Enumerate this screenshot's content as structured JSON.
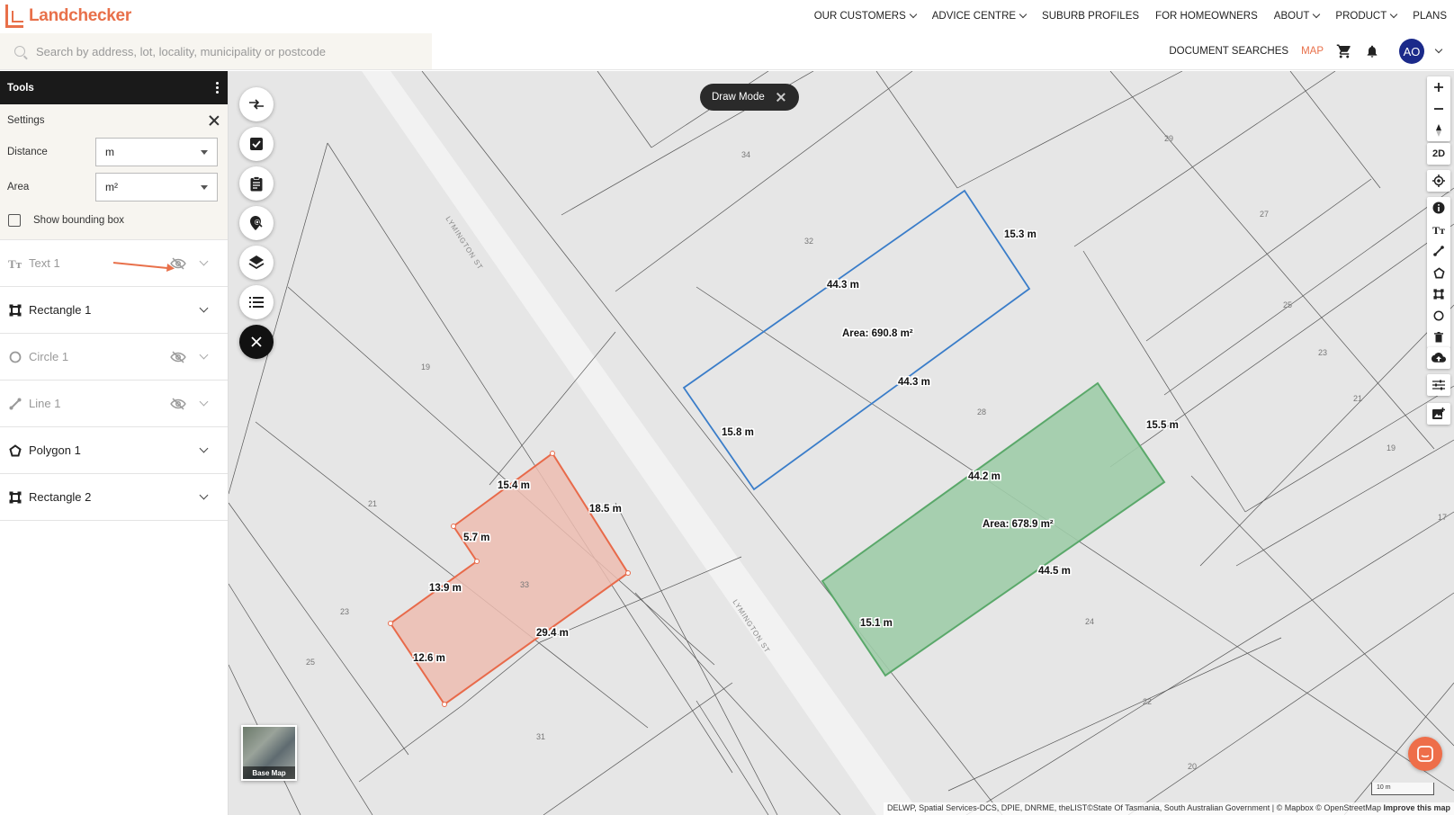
{
  "brand": {
    "name": "Landchecker",
    "color": "#e8704a"
  },
  "nav": [
    {
      "label": "OUR CUSTOMERS",
      "dropdown": true
    },
    {
      "label": "ADVICE CENTRE",
      "dropdown": true
    },
    {
      "label": "SUBURB PROFILES",
      "dropdown": false
    },
    {
      "label": "FOR HOMEOWNERS",
      "dropdown": false
    },
    {
      "label": "ABOUT",
      "dropdown": true
    },
    {
      "label": "PRODUCT",
      "dropdown": true
    },
    {
      "label": "PLANS",
      "dropdown": false
    }
  ],
  "search": {
    "placeholder": "Search by address, lot, locality, municipality or postcode",
    "value": ""
  },
  "subnav": {
    "document_searches": "DOCUMENT SEARCHES",
    "map": "MAP",
    "avatar_initials": "AO"
  },
  "sidebar": {
    "title": "Tools",
    "settings": {
      "title": "Settings",
      "distance_label": "Distance",
      "distance_value": "m",
      "area_label": "Area",
      "area_value": "m²",
      "bounding_box_label": "Show bounding box",
      "bounding_box_checked": false
    },
    "layers": [
      {
        "name": "Text 1",
        "icon": "text-icon",
        "hidden": true
      },
      {
        "name": "Rectangle 1",
        "icon": "rectangle-icon",
        "hidden": false
      },
      {
        "name": "Circle 1",
        "icon": "circle-icon",
        "hidden": true
      },
      {
        "name": "Line 1",
        "icon": "line-icon",
        "hidden": true
      },
      {
        "name": "Polygon 1",
        "icon": "polygon-icon",
        "hidden": false
      },
      {
        "name": "Rectangle 2",
        "icon": "rectangle-icon",
        "hidden": false
      }
    ]
  },
  "map": {
    "draw_mode_label": "Draw Mode",
    "view_toggle": "2D",
    "base_map_label": "Base Map",
    "scale_label": "10 m",
    "attribution": "DELWP, Spatial Services-DCS, DPIE, DNRME, theLIST©State Of Tasmania, South Australian Government | © Mapbox © OpenStreetMap",
    "attribution_link": "Improve this map",
    "streets": [
      "LYMINGTON ST",
      "LYMINGTON ST"
    ],
    "parcel_numbers": [
      "34",
      "29",
      "32",
      "27",
      "25",
      "23",
      "21",
      "19",
      "17",
      "28",
      "24",
      "22",
      "20",
      "19",
      "21",
      "23",
      "25",
      "33",
      "31"
    ],
    "blue_shape": {
      "color": "#3a7dc9",
      "edges": [
        "15.3 m",
        "44.3 m",
        "44.3 m",
        "15.8 m"
      ],
      "area": "Area: 690.8 m²"
    },
    "green_shape": {
      "color": "#5aa86a",
      "edges": [
        "15.5 m",
        "44.2 m",
        "44.5 m",
        "15.1 m"
      ],
      "area": "Area: 678.9 m²"
    },
    "red_shape": {
      "color": "#e86a4a",
      "edges": [
        "15.4 m",
        "18.5 m",
        "5.7 m",
        "13.9 m",
        "29.4 m",
        "12.6 m"
      ]
    }
  }
}
